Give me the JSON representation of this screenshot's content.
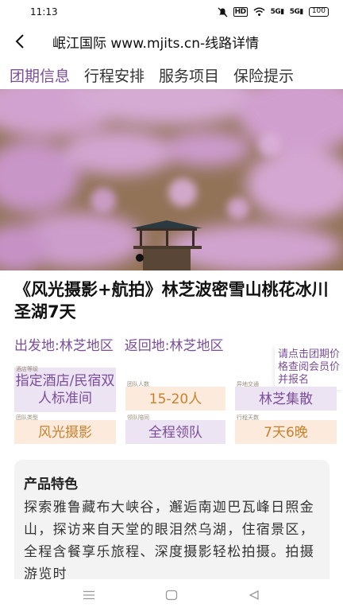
{
  "status_bar": {
    "time": "11:13",
    "network_label": "HD",
    "signal_1": "5G",
    "signal_2": "5G",
    "battery": "100"
  },
  "nav": {
    "back_icon": "back-arrow-icon",
    "title": "岷江国际 www.mjits.cn-线路详情"
  },
  "tabs": [
    {
      "label": "团期信息",
      "active": true
    },
    {
      "label": "行程安排",
      "active": false
    },
    {
      "label": "服务项目",
      "active": false
    },
    {
      "label": "保险提示",
      "active": false
    }
  ],
  "trip": {
    "title": "《风光摄影+航拍》林芝波密雪山桃花冰川圣湖7天",
    "departure": "出发地:林芝地区",
    "return": "返回地:林芝地区",
    "price_tip": "请点击团期价格查阅会员价并报名"
  },
  "info_cards": [
    {
      "label": "酒店等级",
      "value": "指定酒店/民宿双人标准间"
    },
    {
      "label": "团队人数",
      "value": "15-20人"
    },
    {
      "label": "异地交通",
      "value": "林芝集散"
    },
    {
      "label": "团队类型",
      "value": "风光摄影"
    },
    {
      "label": "领队陪同",
      "value": "全程领队"
    },
    {
      "label": "行程天数",
      "value": "7天6晚"
    }
  ],
  "feature": {
    "title": "产品特色",
    "text": "探索雅鲁藏布大峡谷，邂逅南迦巴瓦峰日照金山，探访来自天堂的眼泪然乌湖，住宿景区，全程含餐享乐旅程、深度摄影轻松拍摄。拍摄游览时"
  },
  "colors": {
    "accent": "#7a4e98",
    "peach_bg": "#fcebdc",
    "purple_bg": "#ece3f3",
    "peach_text": "#c8822e"
  },
  "bottom_nav": [
    "menu-icon",
    "home-icon",
    "back-triangle-icon"
  ]
}
